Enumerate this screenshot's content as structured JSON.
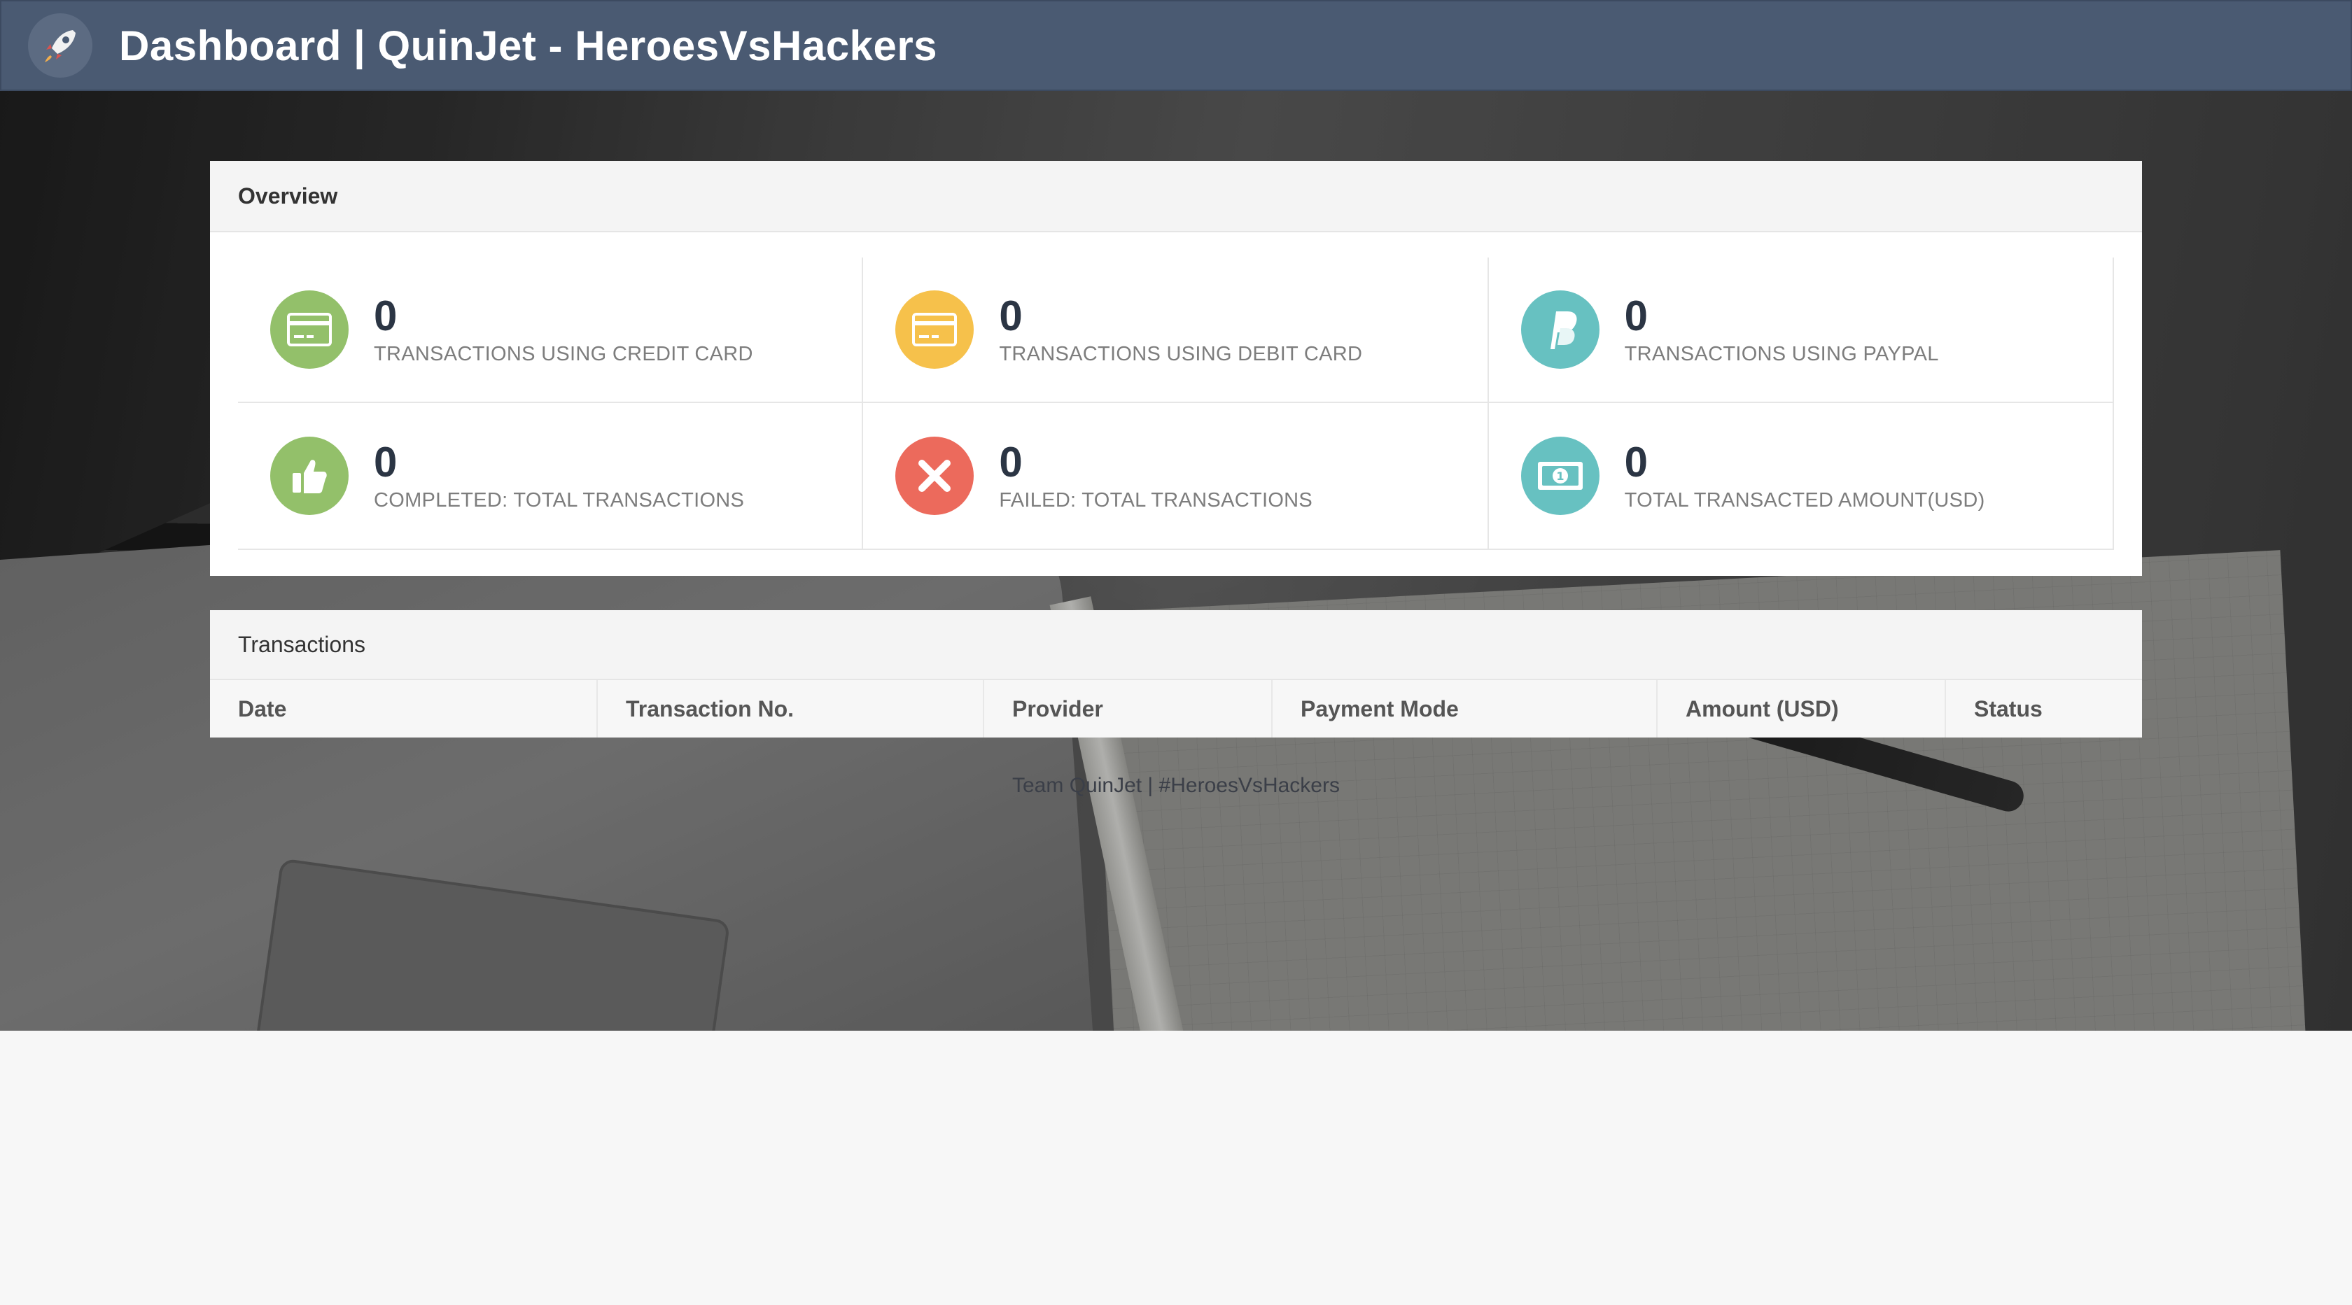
{
  "header": {
    "title": "Dashboard | QuinJet - HeroesVsHackers",
    "logo_icon": "rocket-icon"
  },
  "overview": {
    "title": "Overview",
    "stats": [
      {
        "value": "0",
        "label": "TRANSACTIONS USING CREDIT CARD",
        "icon": "credit-card-icon",
        "color": "#93c06a"
      },
      {
        "value": "0",
        "label": "TRANSACTIONS USING DEBIT CARD",
        "icon": "debit-card-icon",
        "color": "#f6c14b"
      },
      {
        "value": "0",
        "label": "TRANSACTIONS USING PAYPAL",
        "icon": "paypal-icon",
        "color": "#67c1c1"
      },
      {
        "value": "0",
        "label": "COMPLETED: TOTAL TRANSACTIONS",
        "icon": "thumbs-up-icon",
        "color": "#93c06a"
      },
      {
        "value": "0",
        "label": "FAILED: TOTAL TRANSACTIONS",
        "icon": "close-icon",
        "color": "#ec6a5c"
      },
      {
        "value": "0",
        "label": "TOTAL TRANSACTED AMOUNT(USD)",
        "icon": "money-icon",
        "color": "#67c1c1"
      }
    ]
  },
  "transactions": {
    "title": "Transactions",
    "columns": [
      "Date",
      "Transaction No.",
      "Provider",
      "Payment Mode",
      "Amount (USD)",
      "Status"
    ]
  },
  "footer": {
    "text": "Team QuinJet | #HeroesVsHackers"
  }
}
